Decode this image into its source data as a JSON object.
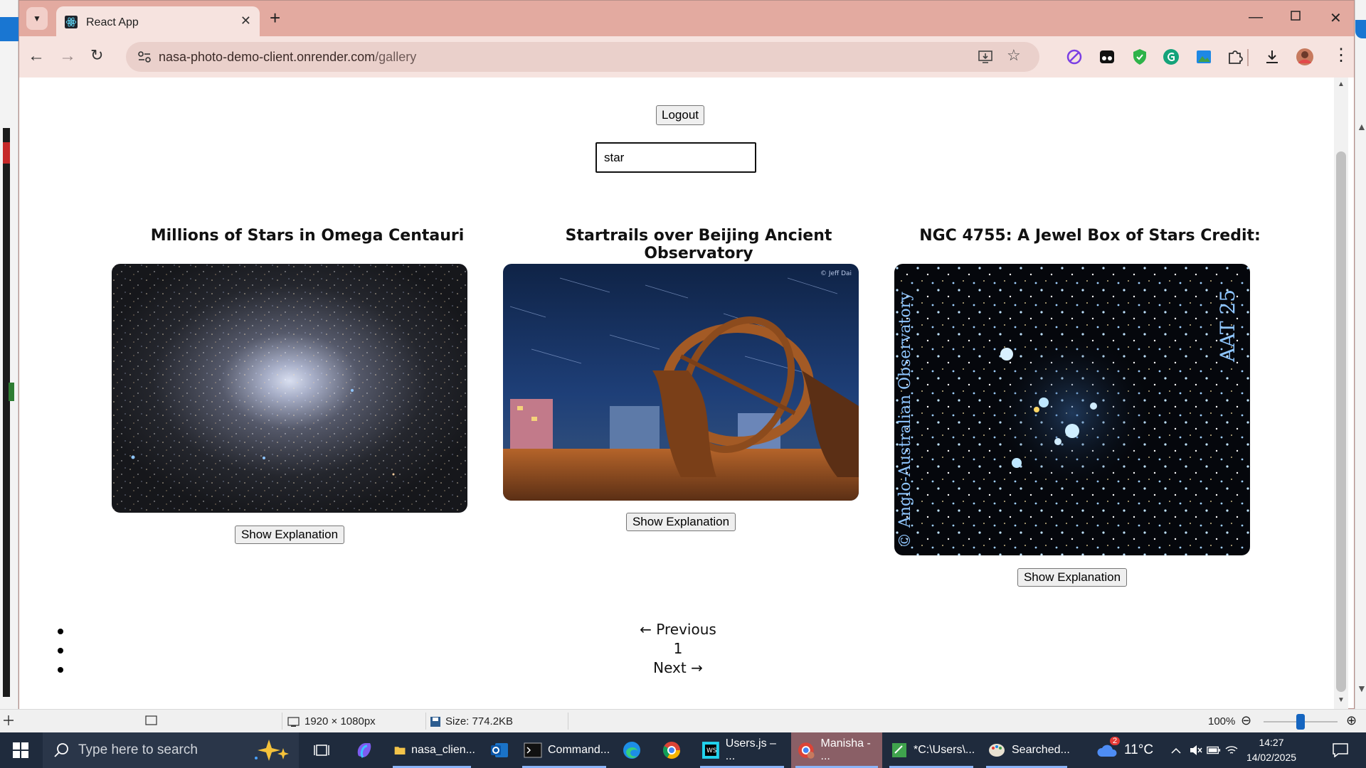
{
  "browser": {
    "tab_title": "React App",
    "url_host": "nasa-photo-demo-client.onrender.com",
    "url_path": "/gallery"
  },
  "page": {
    "logout_label": "Logout",
    "search_value": "star",
    "show_explanation_label": "Show Explanation",
    "cards": [
      {
        "title": "Millions of Stars in Omega Centauri"
      },
      {
        "title": "Startrails over Beijing Ancient Observatory",
        "image_credit": "© Jeff Dai"
      },
      {
        "title": "NGC 4755: A Jewel Box of Stars Credit:",
        "image_text_vertical": "© Anglo-Australian Observatory",
        "image_text_corner": "AAT 25"
      }
    ],
    "pagination": {
      "previous_label": "← Previous",
      "current_page": "1",
      "next_label": "Next →"
    }
  },
  "statusbar": {
    "dimensions": "1920 × 1080px",
    "size": "Size: 774.2KB",
    "zoom": "100%"
  },
  "taskbar": {
    "search_placeholder": "Type here to search",
    "items": [
      {
        "label": "nasa_clien..."
      },
      {
        "label": "Command..."
      },
      {
        "label": "Users.js – ..."
      },
      {
        "label": "Manisha - ..."
      },
      {
        "label": "*C:\\Users\\..."
      },
      {
        "label": "Searched..."
      }
    ],
    "weather_temp": "11°C",
    "weather_badge": "2",
    "time": "14:27",
    "date": "14/02/2025"
  },
  "colors": {
    "tabbar": "#e3aaa0",
    "toolbar": "#f6e3df",
    "taskbar": "#1f2b3d"
  }
}
